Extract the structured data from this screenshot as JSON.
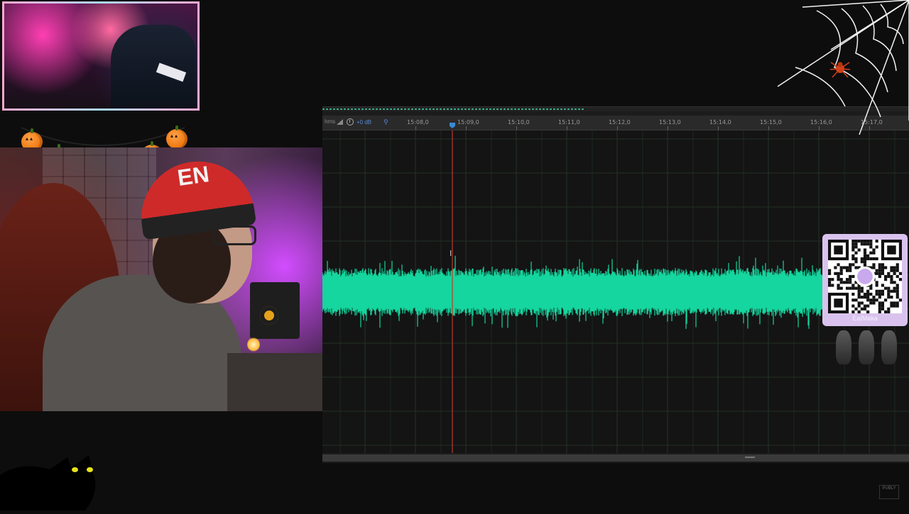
{
  "editor": {
    "time_format_label": "hms",
    "volume_label": "+0 dB",
    "ruler_ticks": [
      "15:08,0",
      "15:09,0",
      "15:10,0",
      "15:11,0",
      "15:12,0",
      "15:13,0",
      "15:14,0",
      "15:15,0",
      "15:16,0",
      "15:17,0"
    ],
    "waveform_color": "#14d69e",
    "playhead_color": "#c0392b"
  },
  "overlay": {
    "qr_label": "EaIMaka",
    "corner_logo": "PUBLY"
  },
  "webcam": {
    "hat_text": "EN"
  },
  "colors": {
    "accent_pumpkin": "#f07a12",
    "qr_card": "#d9c3ee",
    "background": "#0d0d0d"
  }
}
